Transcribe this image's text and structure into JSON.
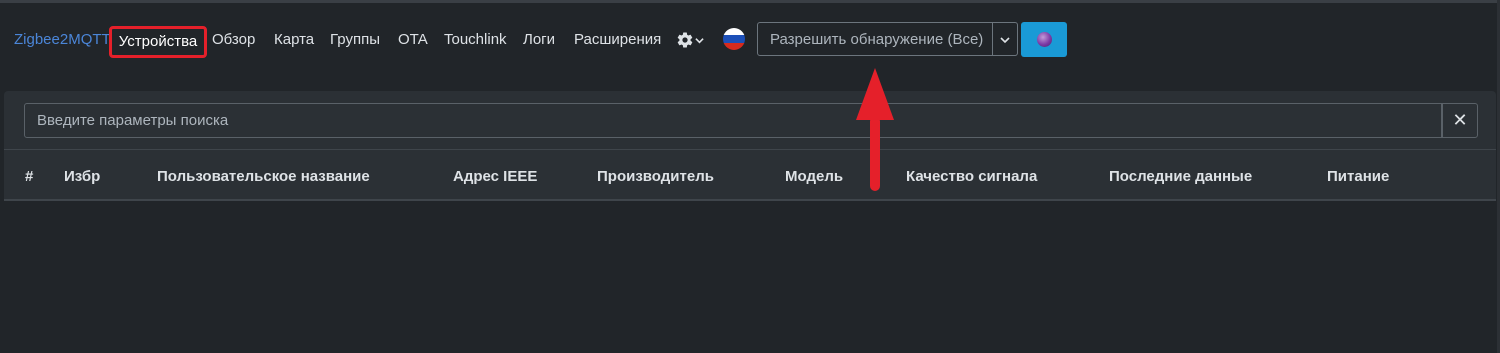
{
  "navbar": {
    "brand": "Zigbee2MQTT",
    "items": [
      {
        "label": "Устройства",
        "active": true
      },
      {
        "label": "Обзор"
      },
      {
        "label": "Карта"
      },
      {
        "label": "Группы"
      },
      {
        "label": "OTA"
      },
      {
        "label": "Touchlink"
      },
      {
        "label": "Логи"
      },
      {
        "label": "Расширения"
      }
    ],
    "settings_icon": "gear-icon",
    "language_flag": "russia-flag-icon",
    "permit_join": {
      "label": "Разрешить обнаружение (Все)",
      "caret_icon": "chevron-down-icon",
      "button_color": "#1a9ad6"
    }
  },
  "devices": {
    "search": {
      "placeholder": "Введите параметры поиска",
      "clear_icon": "close-icon"
    },
    "columns": [
      "#",
      "Избр",
      "Пользовательское название",
      "Адрес IEEE",
      "Производитель",
      "Модель",
      "Качество сигнала",
      "Последние данные",
      "Питание"
    ],
    "rows": []
  },
  "annotation": {
    "highlight_color": "#e5202a",
    "arrow_color": "#e5202a"
  }
}
